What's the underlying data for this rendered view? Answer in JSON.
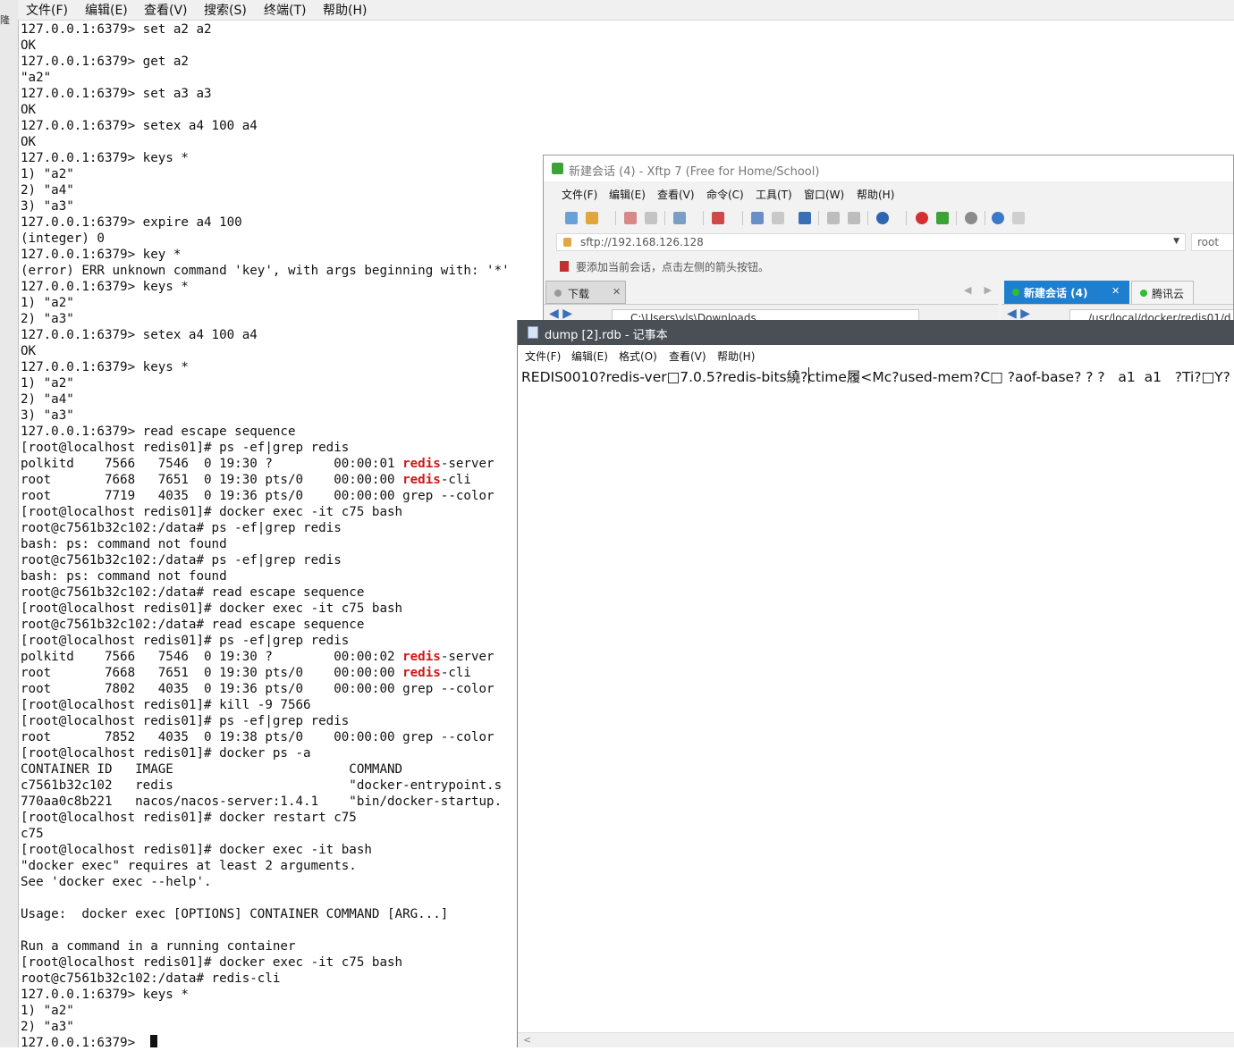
{
  "terminal": {
    "gutter_label": "隆",
    "menu": [
      "文件(F)",
      "编辑(E)",
      "查看(V)",
      "搜索(S)",
      "终端(T)",
      "帮助(H)"
    ],
    "lines": [
      [
        {
          "t": "127.0.0.1:6379> set a2 a2"
        }
      ],
      [
        {
          "t": "OK"
        }
      ],
      [
        {
          "t": "127.0.0.1:6379> get a2"
        }
      ],
      [
        {
          "t": "\"a2\""
        }
      ],
      [
        {
          "t": "127.0.0.1:6379> set a3 a3"
        }
      ],
      [
        {
          "t": "OK"
        }
      ],
      [
        {
          "t": "127.0.0.1:6379> setex a4 100 a4"
        }
      ],
      [
        {
          "t": "OK"
        }
      ],
      [
        {
          "t": "127.0.0.1:6379> keys *"
        }
      ],
      [
        {
          "t": "1) \"a2\""
        }
      ],
      [
        {
          "t": "2) \"a4\""
        }
      ],
      [
        {
          "t": "3) \"a3\""
        }
      ],
      [
        {
          "t": "127.0.0.1:6379> expire a4 100"
        }
      ],
      [
        {
          "t": "(integer) 0"
        }
      ],
      [
        {
          "t": "127.0.0.1:6379> key *"
        }
      ],
      [
        {
          "t": "(error) ERR unknown command 'key', with args beginning with: '*'"
        }
      ],
      [
        {
          "t": "127.0.0.1:6379> keys *"
        }
      ],
      [
        {
          "t": "1) \"a2\""
        }
      ],
      [
        {
          "t": "2) \"a3\""
        }
      ],
      [
        {
          "t": "127.0.0.1:6379> setex a4 100 a4"
        }
      ],
      [
        {
          "t": "OK"
        }
      ],
      [
        {
          "t": "127.0.0.1:6379> keys *"
        }
      ],
      [
        {
          "t": "1) \"a2\""
        }
      ],
      [
        {
          "t": "2) \"a4\""
        }
      ],
      [
        {
          "t": "3) \"a3\""
        }
      ],
      [
        {
          "t": "127.0.0.1:6379> read escape sequence"
        }
      ],
      [
        {
          "t": "[root@localhost redis01]# ps -ef|grep redis"
        }
      ],
      [
        {
          "t": "polkitd    7566   7546  0 19:30 ?        00:00:01 "
        },
        {
          "t": "redis",
          "red": true
        },
        {
          "t": "-server"
        }
      ],
      [
        {
          "t": "root       7668   7651  0 19:30 pts/0    00:00:00 "
        },
        {
          "t": "redis",
          "red": true
        },
        {
          "t": "-cli"
        }
      ],
      [
        {
          "t": "root       7719   4035  0 19:36 pts/0    00:00:00 grep --color"
        }
      ],
      [
        {
          "t": "[root@localhost redis01]# docker exec -it c75 bash"
        }
      ],
      [
        {
          "t": "root@c7561b32c102:/data# ps -ef|grep redis"
        }
      ],
      [
        {
          "t": "bash: ps: command not found"
        }
      ],
      [
        {
          "t": "root@c7561b32c102:/data# ps -ef|grep redis"
        }
      ],
      [
        {
          "t": "bash: ps: command not found"
        }
      ],
      [
        {
          "t": "root@c7561b32c102:/data# read escape sequence"
        }
      ],
      [
        {
          "t": "[root@localhost redis01]# docker exec -it c75 bash"
        }
      ],
      [
        {
          "t": "root@c7561b32c102:/data# read escape sequence"
        }
      ],
      [
        {
          "t": "[root@localhost redis01]# ps -ef|grep redis"
        }
      ],
      [
        {
          "t": "polkitd    7566   7546  0 19:30 ?        00:00:02 "
        },
        {
          "t": "redis",
          "red": true
        },
        {
          "t": "-server"
        }
      ],
      [
        {
          "t": "root       7668   7651  0 19:30 pts/0    00:00:00 "
        },
        {
          "t": "redis",
          "red": true
        },
        {
          "t": "-cli"
        }
      ],
      [
        {
          "t": "root       7802   4035  0 19:36 pts/0    00:00:00 grep --color"
        }
      ],
      [
        {
          "t": "[root@localhost redis01]# kill -9 7566"
        }
      ],
      [
        {
          "t": "[root@localhost redis01]# ps -ef|grep redis"
        }
      ],
      [
        {
          "t": "root       7852   4035  0 19:38 pts/0    00:00:00 grep --color"
        }
      ],
      [
        {
          "t": "[root@localhost redis01]# docker ps -a"
        }
      ],
      [
        {
          "t": "CONTAINER ID   IMAGE                       COMMAND"
        }
      ],
      [
        {
          "t": "c7561b32c102   redis                       \"docker-entrypoint.s"
        }
      ],
      [
        {
          "t": "770aa0c8b221   nacos/nacos-server:1.4.1    \"bin/docker-startup."
        }
      ],
      [
        {
          "t": "[root@localhost redis01]# docker restart c75"
        }
      ],
      [
        {
          "t": "c75"
        }
      ],
      [
        {
          "t": "[root@localhost redis01]# docker exec -it bash"
        }
      ],
      [
        {
          "t": "\"docker exec\" requires at least 2 arguments."
        }
      ],
      [
        {
          "t": "See 'docker exec --help'."
        }
      ],
      [
        {
          "t": ""
        }
      ],
      [
        {
          "t": "Usage:  docker exec [OPTIONS] CONTAINER COMMAND [ARG...]"
        }
      ],
      [
        {
          "t": ""
        }
      ],
      [
        {
          "t": "Run a command in a running container"
        }
      ],
      [
        {
          "t": "[root@localhost redis01]# docker exec -it c75 bash"
        }
      ],
      [
        {
          "t": "root@c7561b32c102:/data# redis-cli"
        }
      ],
      [
        {
          "t": "127.0.0.1:6379> keys *"
        }
      ],
      [
        {
          "t": "1) \"a2\""
        }
      ],
      [
        {
          "t": "2) \"a3\""
        }
      ],
      [
        {
          "t": "127.0.0.1:6379> "
        }
      ]
    ]
  },
  "xftp": {
    "title": "新建会话 (4)  - Xftp 7 (Free for Home/School)",
    "menu": [
      "文件(F)",
      "编辑(E)",
      "查看(V)",
      "命令(C)",
      "工具(T)",
      "窗口(W)",
      "帮助(H)"
    ],
    "address": "sftp://192.168.126.128",
    "user": "root",
    "hint": "要添加当前会话，点击左侧的箭头按钮。",
    "tab_local": "下载",
    "tab_active": "新建会话 (4)",
    "tab_other": "腾讯云",
    "local_path": "C:\\Users\\yls\\Downloads",
    "remote_path": "/usr/local/docker/redis01/d",
    "colors": {
      "active_tab": "#1e7fd0",
      "session_dot": "#2fbf2f"
    }
  },
  "notepad": {
    "title": "dump [2].rdb - 记事本",
    "menu": [
      "文件(F)",
      "编辑(E)",
      "格式(O)",
      "查看(V)",
      "帮助(H)"
    ],
    "content": "REDIS0010?redis-ver□7.0.5?redis-bits繞?ctime履<Mc?used-mem?C□ ?aof-base? ? ?   a1  a1   ?Ti?□Y?"
  }
}
